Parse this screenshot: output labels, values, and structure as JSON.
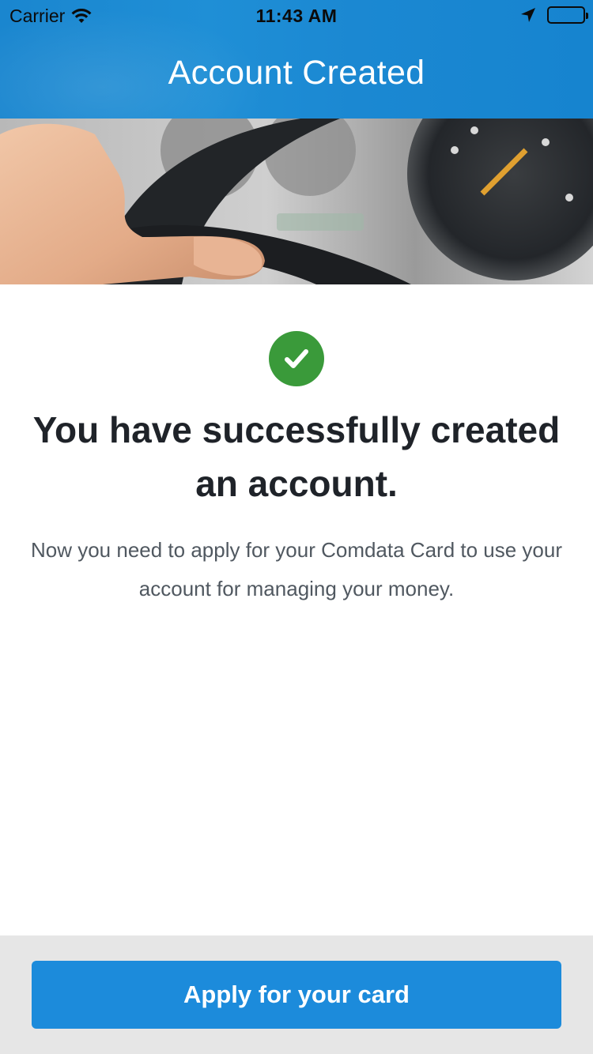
{
  "status_bar": {
    "carrier": "Carrier",
    "time": "11:43 AM",
    "icons": [
      "wifi-icon",
      "location-arrow-icon",
      "battery-icon"
    ]
  },
  "nav": {
    "title": "Account Created"
  },
  "hero": {
    "image": "hand-on-steering-wheel-photo"
  },
  "content": {
    "status_icon": "checkmark-circle-icon",
    "headline": "You have successfully created an account.",
    "body": "Now you need to apply for your Comdata Card to use your account for managing your money."
  },
  "footer": {
    "apply_label": "Apply for your card"
  },
  "colors": {
    "nav_blue": "#1b88d2",
    "button_blue": "#1c8bdb",
    "success_green": "#3a9a3a",
    "footer_gray": "#e6e6e6"
  }
}
